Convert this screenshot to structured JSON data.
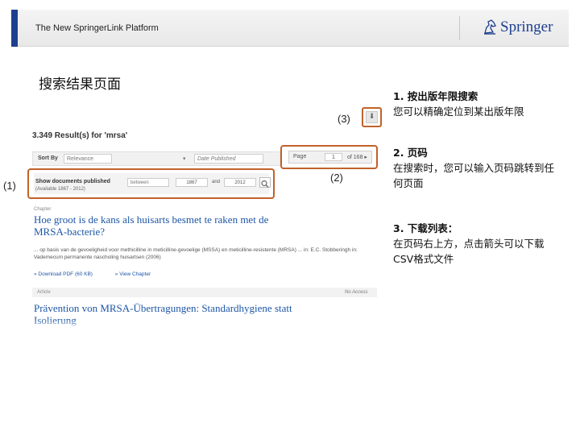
{
  "header": {
    "platform_title": "The New SpringerLink Platform",
    "brand": "Springer"
  },
  "slide_title": "搜索结果页面",
  "markers": {
    "m3": "(3)",
    "m2": "(2)",
    "m1": "(1)"
  },
  "results": {
    "summary": "3.349 Result(s) for 'mrsa'"
  },
  "sort": {
    "label": "Sort By",
    "value": "Relevance",
    "arrow": "▾",
    "date_published": "Date Published"
  },
  "pager": {
    "label": "Page",
    "current": "1",
    "of_total": "of 168 ▸"
  },
  "filter": {
    "title": "Show documents published",
    "subtitle": "(Available 1867 - 2012)",
    "mode": "between",
    "from_year": "1867",
    "and_label": "and",
    "to_year": "2012"
  },
  "download": {
    "arrow": "⬇"
  },
  "articles": [
    {
      "type": "Chapter",
      "title": "Hoe groot is de kans als huisarts besmet te raken met de MRSA-bacterie?",
      "snippet": "... op basis van de gevoeligheid voor methicilline in meticilline-gevoelige (MSSA) en meticilline-resistente (MRSA) ... in: E.C. Stobberingh in: Vademecum permanente nascholing huisartsen (2006)",
      "links": [
        "» Download PDF (60 KB)",
        "» View Chapter"
      ]
    },
    {
      "type": "Article",
      "access": "No Access",
      "title": "Prävention von MRSA-Übertragungen: Standardhygiene statt Isolierung"
    }
  ],
  "notes": [
    {
      "title": "1.  按出版年限搜索",
      "body": "您可以精确定位到某出版年限"
    },
    {
      "title": "2.  页码",
      "body": "在搜索时，您可以输入页码跳转到任何页面"
    },
    {
      "title": "3.  下载列表：",
      "body": "在页码右上方，点击箭头可以下载CSV格式文件"
    }
  ],
  "colors": {
    "accent_blue": "#1d3f8f",
    "highlight_orange": "#c0622a",
    "link_blue": "#1d56a6"
  }
}
